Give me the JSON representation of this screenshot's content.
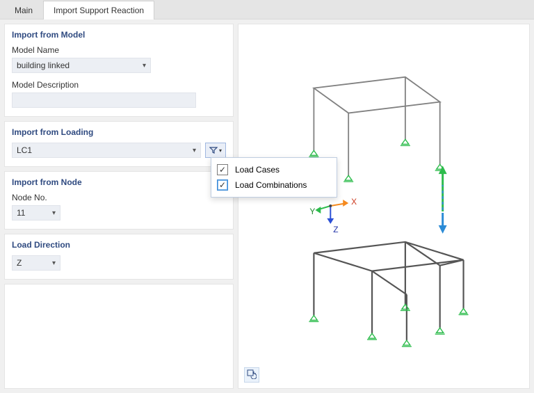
{
  "tabs": {
    "main": "Main",
    "import": "Import Support Reaction"
  },
  "importFromModel": {
    "title": "Import from Model",
    "modelNameLabel": "Model Name",
    "modelName": "building linked",
    "modelDescriptionLabel": "Model Description",
    "modelDescription": ""
  },
  "importFromLoading": {
    "title": "Import from Loading",
    "value": "LC1",
    "filterOptions": {
      "loadCases": "Load Cases",
      "loadCombinations": "Load Combinations"
    }
  },
  "importFromNode": {
    "title": "Import from Node",
    "nodeNoLabel": "Node No.",
    "nodeNo": "11"
  },
  "loadDirection": {
    "title": "Load Direction",
    "value": "Z"
  },
  "axes": {
    "x": "X",
    "y": "Y",
    "z": "Z"
  }
}
